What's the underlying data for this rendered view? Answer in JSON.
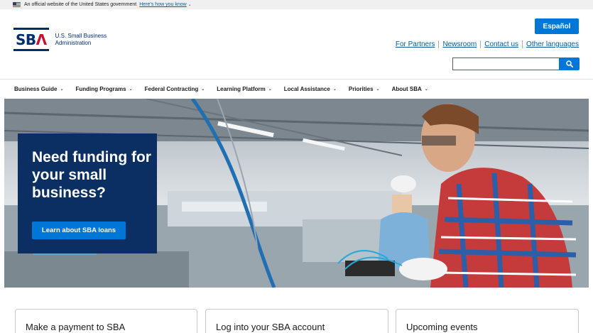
{
  "gov_banner": {
    "text": "An official website of the United States government",
    "link": "Here’s how you know",
    "chevron": "⌄"
  },
  "logo": {
    "letters_sb": "SB",
    "letter_a": "Λ",
    "line1": "U.S. Small Business",
    "line2": "Administration"
  },
  "header": {
    "espanol": "Español",
    "utility_links": [
      "For Partners",
      "Newsroom",
      "Contact us",
      "Other languages"
    ],
    "search": {
      "value": "",
      "placeholder": ""
    }
  },
  "nav": [
    "Business Guide",
    "Funding Programs",
    "Federal Contracting",
    "Learning Platform",
    "Local Assistance",
    "Priorities",
    "About SBA"
  ],
  "hero": {
    "title": "Need funding for your small business?",
    "button": "Learn about SBA loans"
  },
  "cards": [
    "Make a payment to SBA",
    "Log into your SBA account",
    "Upcoming events"
  ],
  "colors": {
    "primary_blue": "#0076d6",
    "link_blue": "#005ea2",
    "navy": "#0b2f63",
    "sba_red": "#c41230"
  },
  "icons": {
    "search": "search-icon",
    "flag": "us-flag-icon",
    "caret": "chevron-down-icon"
  }
}
